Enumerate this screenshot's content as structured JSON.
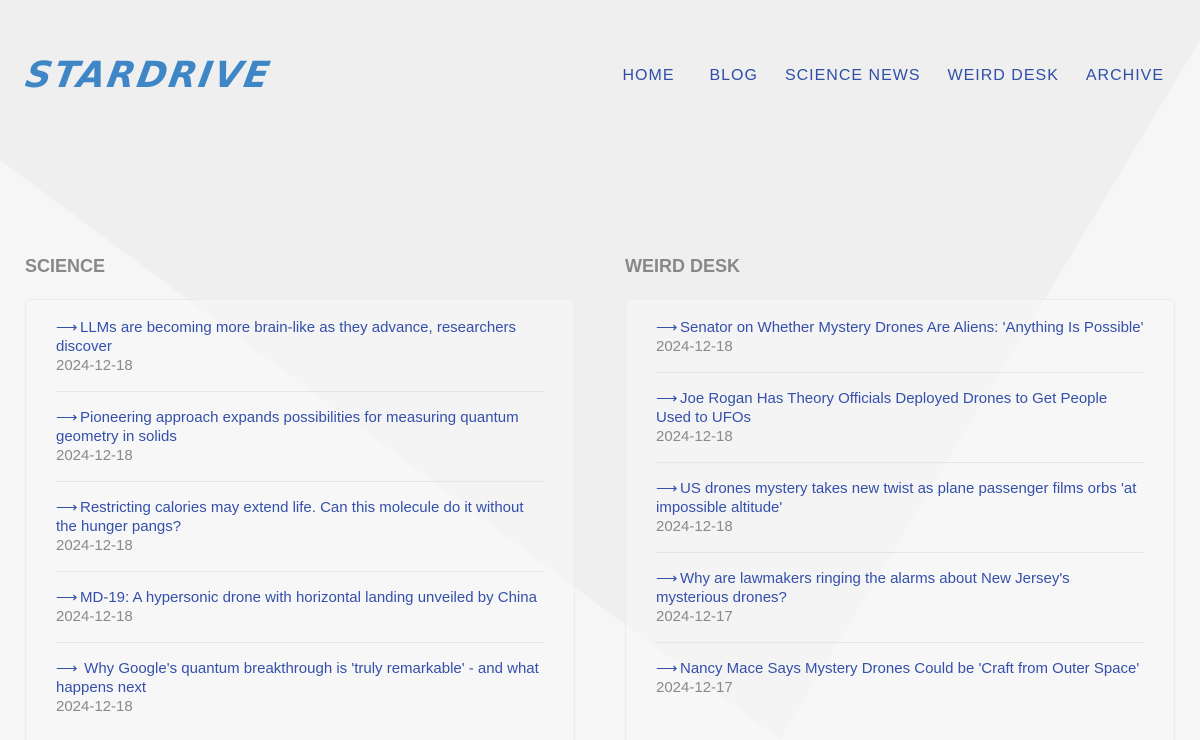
{
  "brand": {
    "logo_text": "STARDRIVE",
    "color": "#3f86c7"
  },
  "nav": {
    "items": [
      {
        "label": "HOME"
      },
      {
        "label": "BLOG"
      },
      {
        "label": "SCIENCE NEWS"
      },
      {
        "label": "WEIRD DESK"
      },
      {
        "label": "ARCHIVE"
      }
    ]
  },
  "colors": {
    "link": "#3550aa",
    "date": "#8a8a8a",
    "section_title": "#888888"
  },
  "sections": [
    {
      "title": "SCIENCE",
      "items": [
        {
          "title": "LLMs are becoming more brain-like as they advance, researchers discover",
          "date": "2024-12-18"
        },
        {
          "title": "Pioneering approach expands possibilities for measuring quantum geometry in solids",
          "date": "2024-12-18"
        },
        {
          "title": "Restricting calories may extend life. Can this molecule do it without the hunger pangs?",
          "date": "2024-12-18"
        },
        {
          "title": "MD-19: A hypersonic drone with horizontal landing unveiled by China",
          "date": "2024-12-18"
        },
        {
          "title": " Why Google's quantum breakthrough is 'truly remarkable' - and what happens next",
          "date": "2024-12-18"
        }
      ]
    },
    {
      "title": "WEIRD DESK",
      "items": [
        {
          "title": "Senator on Whether Mystery Drones Are Aliens: 'Anything Is Possible'",
          "date": "2024-12-18"
        },
        {
          "title": "Joe Rogan Has Theory Officials Deployed Drones to Get People Used to UFOs",
          "date": "2024-12-18"
        },
        {
          "title": "US drones mystery takes new twist as plane passenger films orbs 'at impossible altitude'",
          "date": "2024-12-18"
        },
        {
          "title": "Why are lawmakers ringing the alarms about New Jersey's mysterious drones?",
          "date": "2024-12-17"
        },
        {
          "title": "Nancy Mace Says Mystery Drones Could be 'Craft from Outer Space'",
          "date": "2024-12-17"
        }
      ]
    }
  ],
  "icons": {
    "item_arrow": "right-arrow-icon"
  }
}
